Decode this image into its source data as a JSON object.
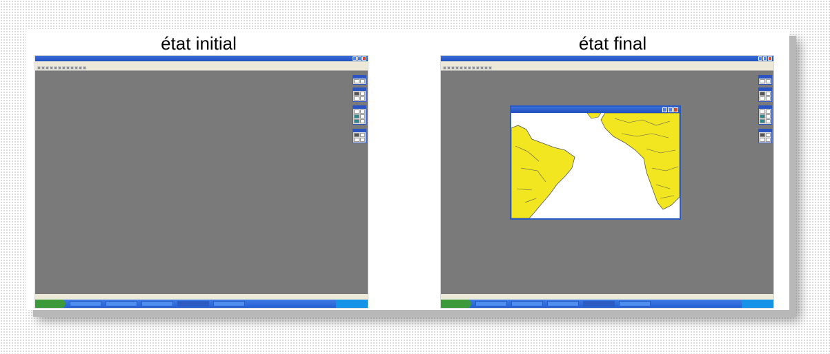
{
  "panels": {
    "left": {
      "title": "état initial"
    },
    "right": {
      "title": "état final"
    }
  },
  "colors": {
    "workspace": "#7a7a7a",
    "titlebar": "#2a5bc7",
    "land": "#f2e620",
    "ocean": "#ffffff",
    "taskbar": "#2f6ee0"
  },
  "icons": [
    "close-icon",
    "maximize-icon",
    "minimize-icon",
    "palette-tool-icon"
  ]
}
